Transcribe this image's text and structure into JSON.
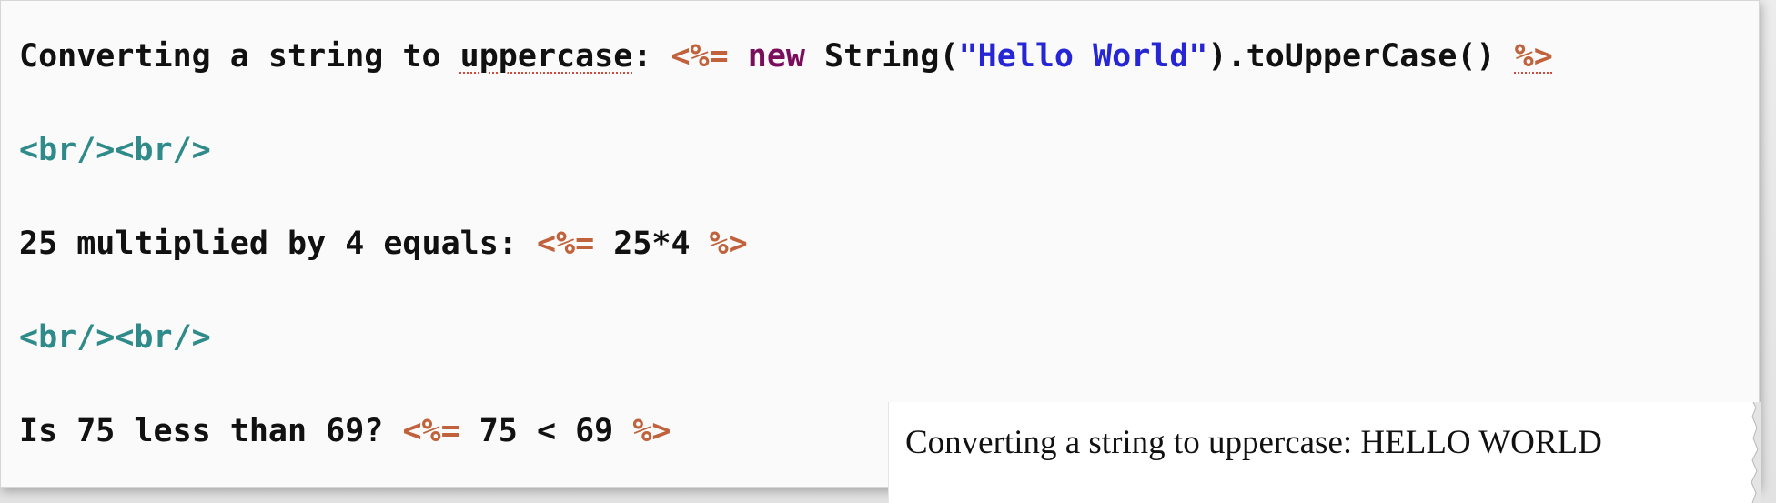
{
  "editor": {
    "line1": {
      "label_a": "Converting a string to ",
      "label_b": "uppercase",
      "label_c": ": ",
      "open_tag": "<%=",
      "space1": " ",
      "keyword": "new",
      "call_open": " String(",
      "string_literal": "\"Hello World\"",
      "call_close": ").toUpperCase() ",
      "close_tag": "%>"
    },
    "line2": {
      "text": "<br/><br/>"
    },
    "line3": {
      "label": "25 multiplied by 4 equals: ",
      "open_tag": "<%=",
      "expr": " 25*4 ",
      "close_tag": "%>"
    },
    "line4": {
      "text": "<br/><br/>"
    },
    "line5": {
      "label": "Is 75 less than 69? ",
      "open_tag": "<%=",
      "expr": " 75 < 69 ",
      "close_tag": "%>"
    }
  },
  "output": {
    "text": "Converting a string to uppercase: HELLO WORLD"
  },
  "colors": {
    "scriptlet_tag": "#c0623b",
    "keyword": "#7a0d5c",
    "string": "#2626d4",
    "html_tag": "#2f8a8a",
    "plain_text": "#111111",
    "spellcheck_underline": "#d24a3a"
  }
}
